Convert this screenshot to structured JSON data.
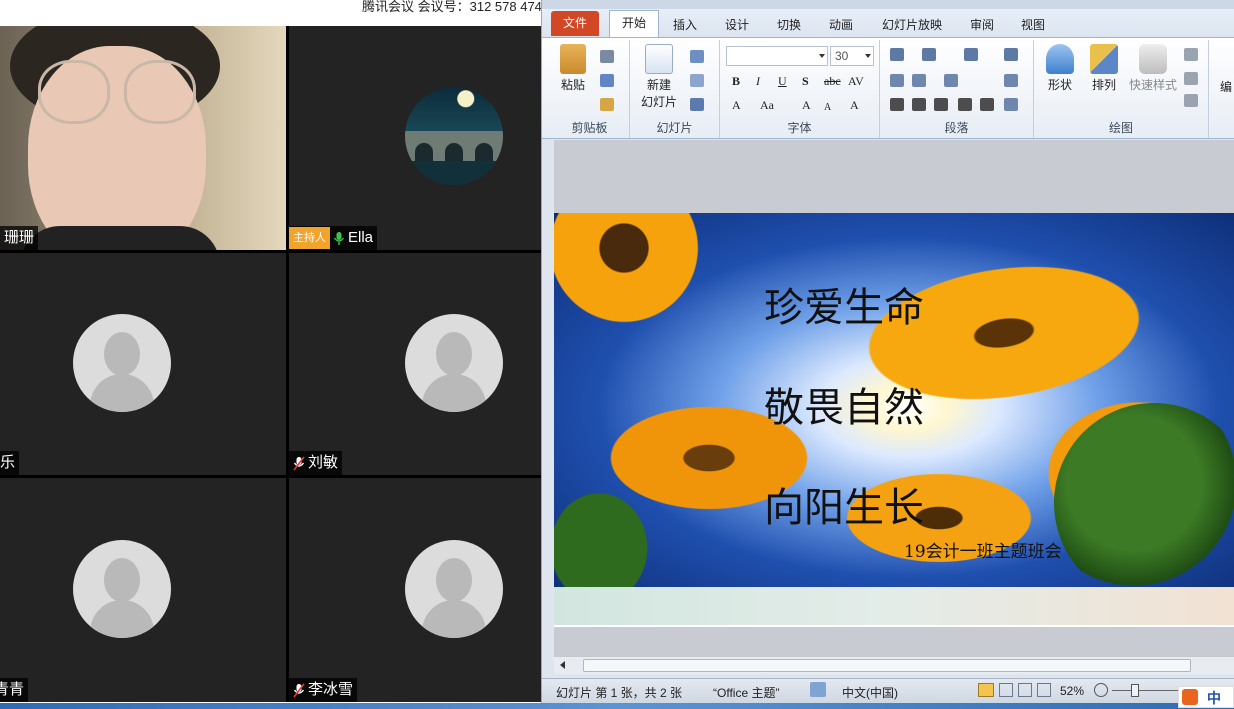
{
  "meeting": {
    "title_bar": "腾讯会议 会议号：312 578 474",
    "participants": [
      {
        "name": "珊珊",
        "muted": false,
        "host": false
      },
      {
        "name": "Ella",
        "muted": false,
        "host": true,
        "host_label": "主持人"
      },
      {
        "name": "乐",
        "muted": false,
        "host": false
      },
      {
        "name": "刘敏",
        "muted": true,
        "host": false
      },
      {
        "name": "青青",
        "muted": false,
        "host": false
      },
      {
        "name": "李冰雪",
        "muted": true,
        "host": false
      }
    ]
  },
  "powerpoint": {
    "tabs": [
      "文件",
      "开始",
      "插入",
      "设计",
      "切换",
      "动画",
      "幻灯片放映",
      "审阅",
      "视图"
    ],
    "active_tab": "开始",
    "groups": {
      "clipboard": {
        "label": "剪贴板",
        "paste": "粘贴"
      },
      "slides": {
        "label": "幻灯片",
        "new_slide_1": "新建",
        "new_slide_2": "幻灯片"
      },
      "font": {
        "label": "字体",
        "font_size": "30"
      },
      "paragraph": {
        "label": "段落"
      },
      "drawing": {
        "label": "绘图",
        "shapes": "形状",
        "arrange": "排列",
        "quick_styles": "快速样式",
        "edit": "编"
      }
    },
    "slide": {
      "line1": "珍爱生命",
      "line2": "敬畏自然",
      "line3": "向阳生长",
      "footer": "19会计一班主题班会"
    },
    "status": {
      "slide_info": "幻灯片 第 1 张，共 2 张",
      "theme": "“Office 主题”",
      "language": "中文(中国)",
      "zoom": "52%"
    },
    "ime": "中"
  }
}
